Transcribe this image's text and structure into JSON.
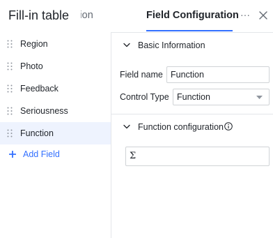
{
  "header": {
    "title": "Fill-in table",
    "tabs": [
      {
        "label": "onfiguration",
        "active": false
      },
      {
        "label": "Field Configuration",
        "active": true
      }
    ],
    "more_icon": "ellipsis-icon",
    "close_icon": "close-icon"
  },
  "sidebar": {
    "items": [
      {
        "label": "Region",
        "selected": false
      },
      {
        "label": "Photo",
        "selected": false
      },
      {
        "label": "Feedback",
        "selected": false
      },
      {
        "label": "Seriousness",
        "selected": false
      },
      {
        "label": "Function",
        "selected": true
      }
    ],
    "add_label": "Add Field"
  },
  "panel": {
    "basic_info": {
      "title": "Basic Information",
      "field_name_label": "Field name",
      "field_name_value": "Function",
      "control_type_label": "Control Type",
      "control_type_value": "Function"
    },
    "function_config": {
      "title": "Function configuration",
      "formula_icon": "sigma-icon",
      "formula_symbol": "Σ"
    }
  },
  "colors": {
    "accent": "#3370ff",
    "selected_bg": "#eef3fe",
    "border": "#e4e6ea"
  }
}
